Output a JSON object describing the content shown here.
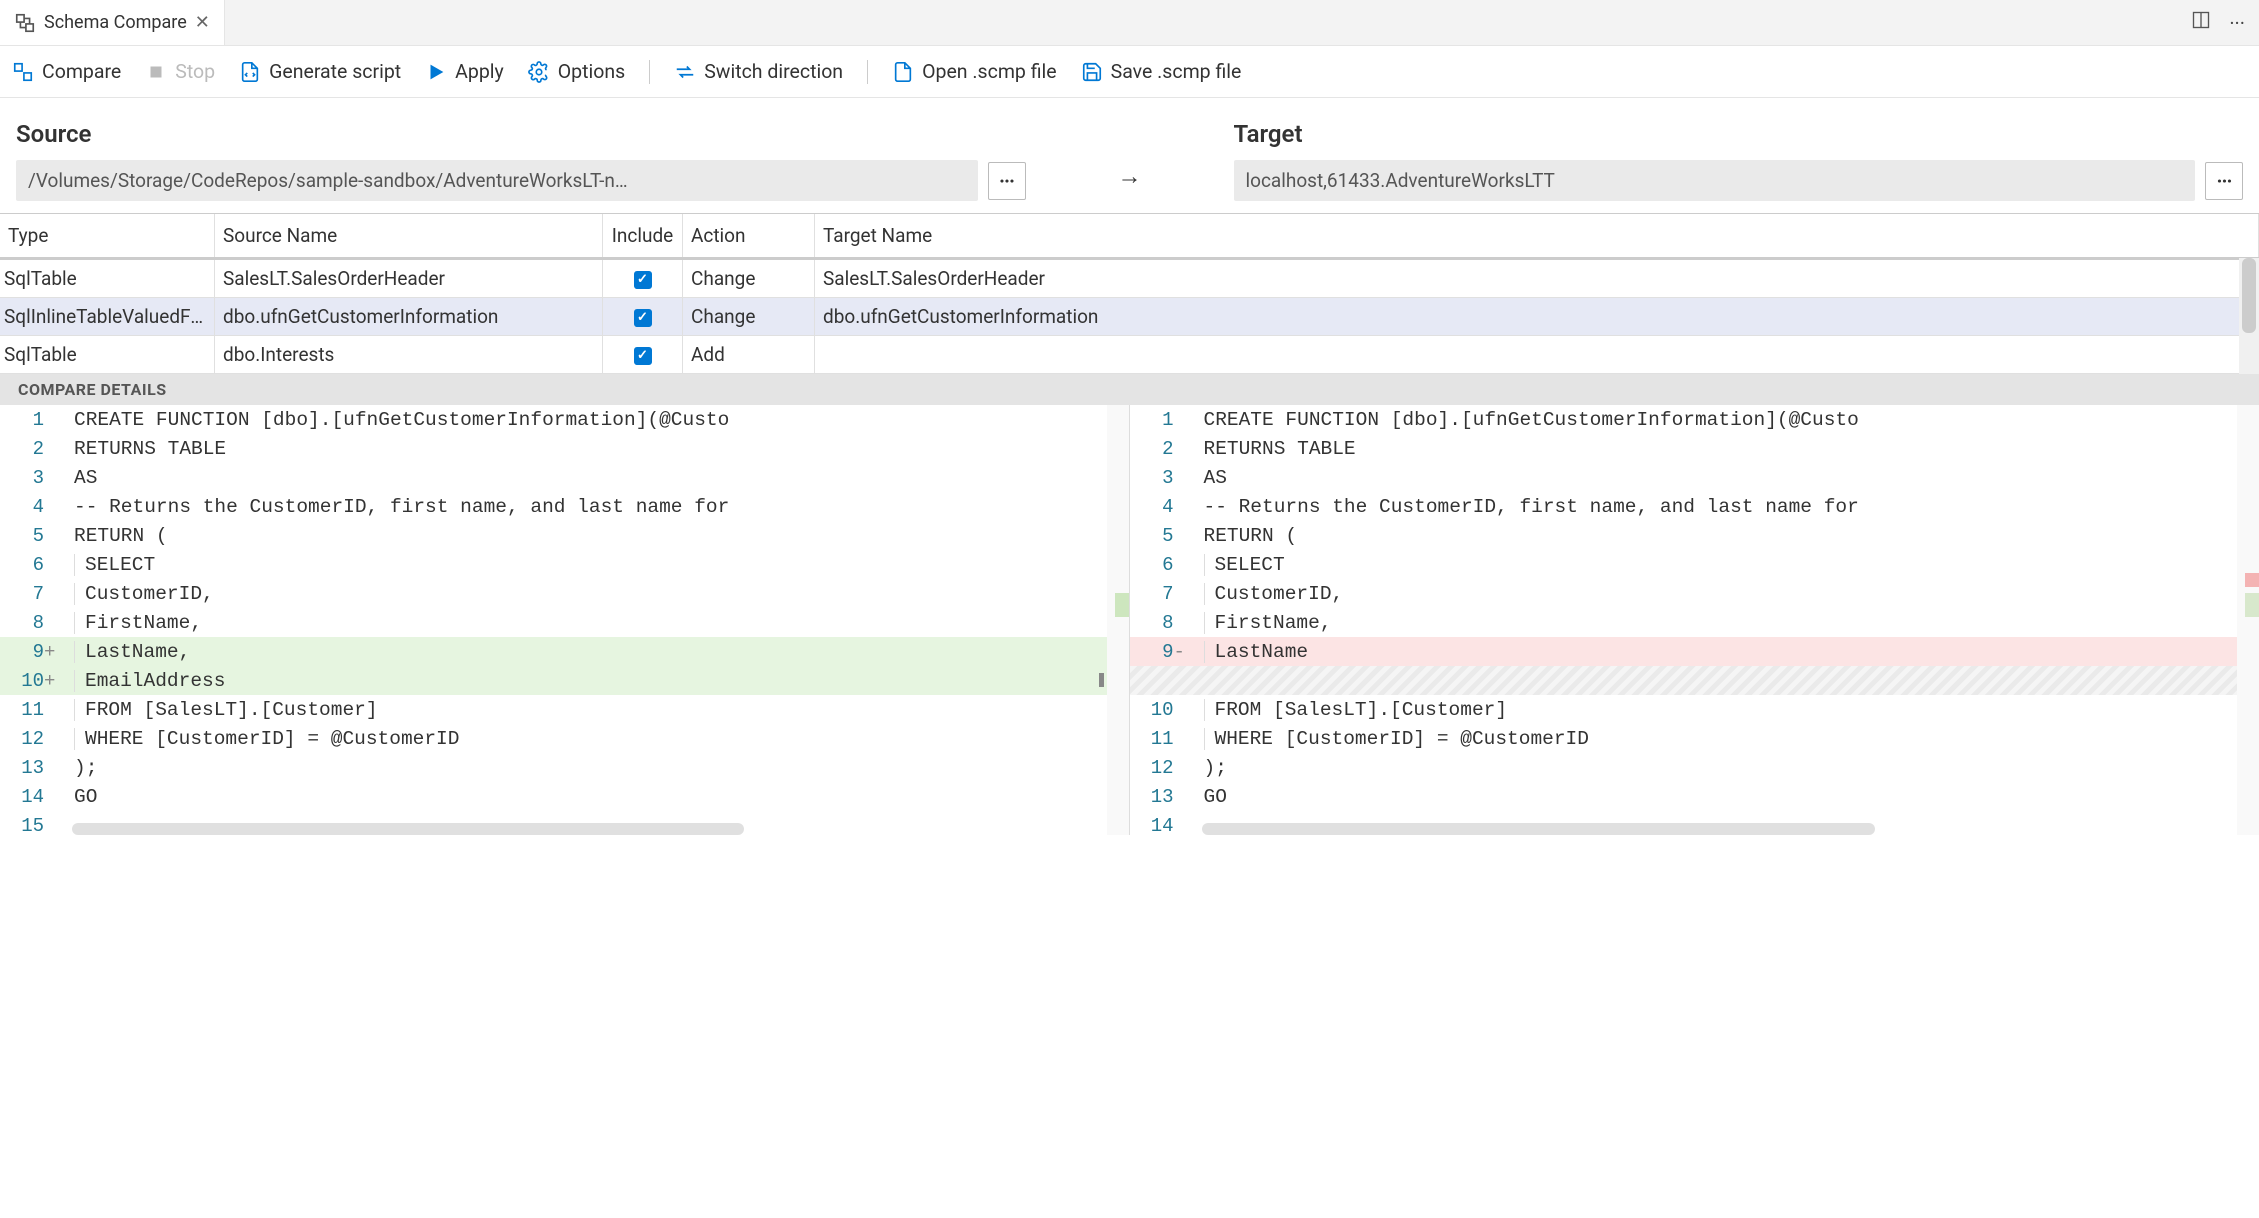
{
  "tab": {
    "title": "Schema Compare"
  },
  "toolbar": {
    "compare": "Compare",
    "stop": "Stop",
    "generate": "Generate script",
    "apply": "Apply",
    "options": "Options",
    "switch": "Switch direction",
    "open": "Open .scmp file",
    "save": "Save .scmp file"
  },
  "source": {
    "title": "Source",
    "value": "/Volumes/Storage/CodeRepos/sample-sandbox/AdventureWorksLT-n…"
  },
  "target": {
    "title": "Target",
    "value": "localhost,61433.AdventureWorksLTT"
  },
  "columns": {
    "type": "Type",
    "sourceName": "Source Name",
    "include": "Include",
    "action": "Action",
    "targetName": "Target Name"
  },
  "rows": [
    {
      "type": "SqlTable",
      "source": "SalesLT.SalesOrderHeader",
      "include": true,
      "action": "Change",
      "target": "SalesLT.SalesOrderHeader",
      "selected": false
    },
    {
      "type": "SqlInlineTableValuedFu…",
      "source": "dbo.ufnGetCustomerInformation",
      "include": true,
      "action": "Change",
      "target": "dbo.ufnGetCustomerInformation",
      "selected": true
    },
    {
      "type": "SqlTable",
      "source": "dbo.Interests",
      "include": true,
      "action": "Add",
      "target": "",
      "selected": false
    }
  ],
  "detailsTitle": "COMPARE DETAILS",
  "leftEditor": [
    {
      "n": "1",
      "m": "",
      "t": "CREATE FUNCTION [dbo].[ufnGetCustomerInformation](@Custo",
      "cls": "",
      "indent": false
    },
    {
      "n": "2",
      "m": "",
      "t": "RETURNS TABLE",
      "cls": "",
      "indent": false
    },
    {
      "n": "3",
      "m": "",
      "t": "AS",
      "cls": "",
      "indent": false
    },
    {
      "n": "4",
      "m": "",
      "t": "-- Returns the CustomerID, first name, and last name for",
      "cls": "",
      "indent": false
    },
    {
      "n": "5",
      "m": "",
      "t": "RETURN (",
      "cls": "",
      "indent": false
    },
    {
      "n": "6",
      "m": "",
      "t": "SELECT",
      "cls": "",
      "indent": true
    },
    {
      "n": "7",
      "m": "",
      "t": "CustomerID,",
      "cls": "",
      "indent": true
    },
    {
      "n": "8",
      "m": "",
      "t": "FirstName,",
      "cls": "",
      "indent": true
    },
    {
      "n": "9",
      "m": "+",
      "t": "LastName,",
      "cls": "add",
      "indent": true
    },
    {
      "n": "10",
      "m": "+",
      "t": "EmailAddress",
      "cls": "add",
      "indent": true
    },
    {
      "n": "11",
      "m": "",
      "t": "FROM [SalesLT].[Customer]",
      "cls": "",
      "indent": true
    },
    {
      "n": "12",
      "m": "",
      "t": "WHERE [CustomerID] = @CustomerID",
      "cls": "",
      "indent": true
    },
    {
      "n": "13",
      "m": "",
      "t": ");",
      "cls": "",
      "indent": false
    },
    {
      "n": "14",
      "m": "",
      "t": "GO",
      "cls": "",
      "indent": false
    },
    {
      "n": "15",
      "m": "",
      "t": "",
      "cls": "",
      "indent": false
    }
  ],
  "rightEditor": [
    {
      "n": "1",
      "m": "",
      "t": "CREATE FUNCTION [dbo].[ufnGetCustomerInformation](@Custo",
      "cls": "",
      "indent": false
    },
    {
      "n": "2",
      "m": "",
      "t": "RETURNS TABLE",
      "cls": "",
      "indent": false
    },
    {
      "n": "3",
      "m": "",
      "t": "AS",
      "cls": "",
      "indent": false
    },
    {
      "n": "4",
      "m": "",
      "t": "-- Returns the CustomerID, first name, and last name for",
      "cls": "",
      "indent": false
    },
    {
      "n": "5",
      "m": "",
      "t": "RETURN (",
      "cls": "",
      "indent": false
    },
    {
      "n": "6",
      "m": "",
      "t": "SELECT",
      "cls": "",
      "indent": true
    },
    {
      "n": "7",
      "m": "",
      "t": "CustomerID,",
      "cls": "",
      "indent": true
    },
    {
      "n": "8",
      "m": "",
      "t": "FirstName,",
      "cls": "",
      "indent": true
    },
    {
      "n": "9",
      "m": "-",
      "t": "LastName",
      "cls": "del",
      "indent": true
    },
    {
      "n": "",
      "m": "",
      "t": "",
      "cls": "placeholder",
      "indent": false
    },
    {
      "n": "10",
      "m": "",
      "t": "FROM [SalesLT].[Customer]",
      "cls": "",
      "indent": true
    },
    {
      "n": "11",
      "m": "",
      "t": "WHERE [CustomerID] = @CustomerID",
      "cls": "",
      "indent": true
    },
    {
      "n": "12",
      "m": "",
      "t": ");",
      "cls": "",
      "indent": false
    },
    {
      "n": "13",
      "m": "",
      "t": "GO",
      "cls": "",
      "indent": false
    },
    {
      "n": "14",
      "m": "",
      "t": "",
      "cls": "",
      "indent": false
    }
  ]
}
